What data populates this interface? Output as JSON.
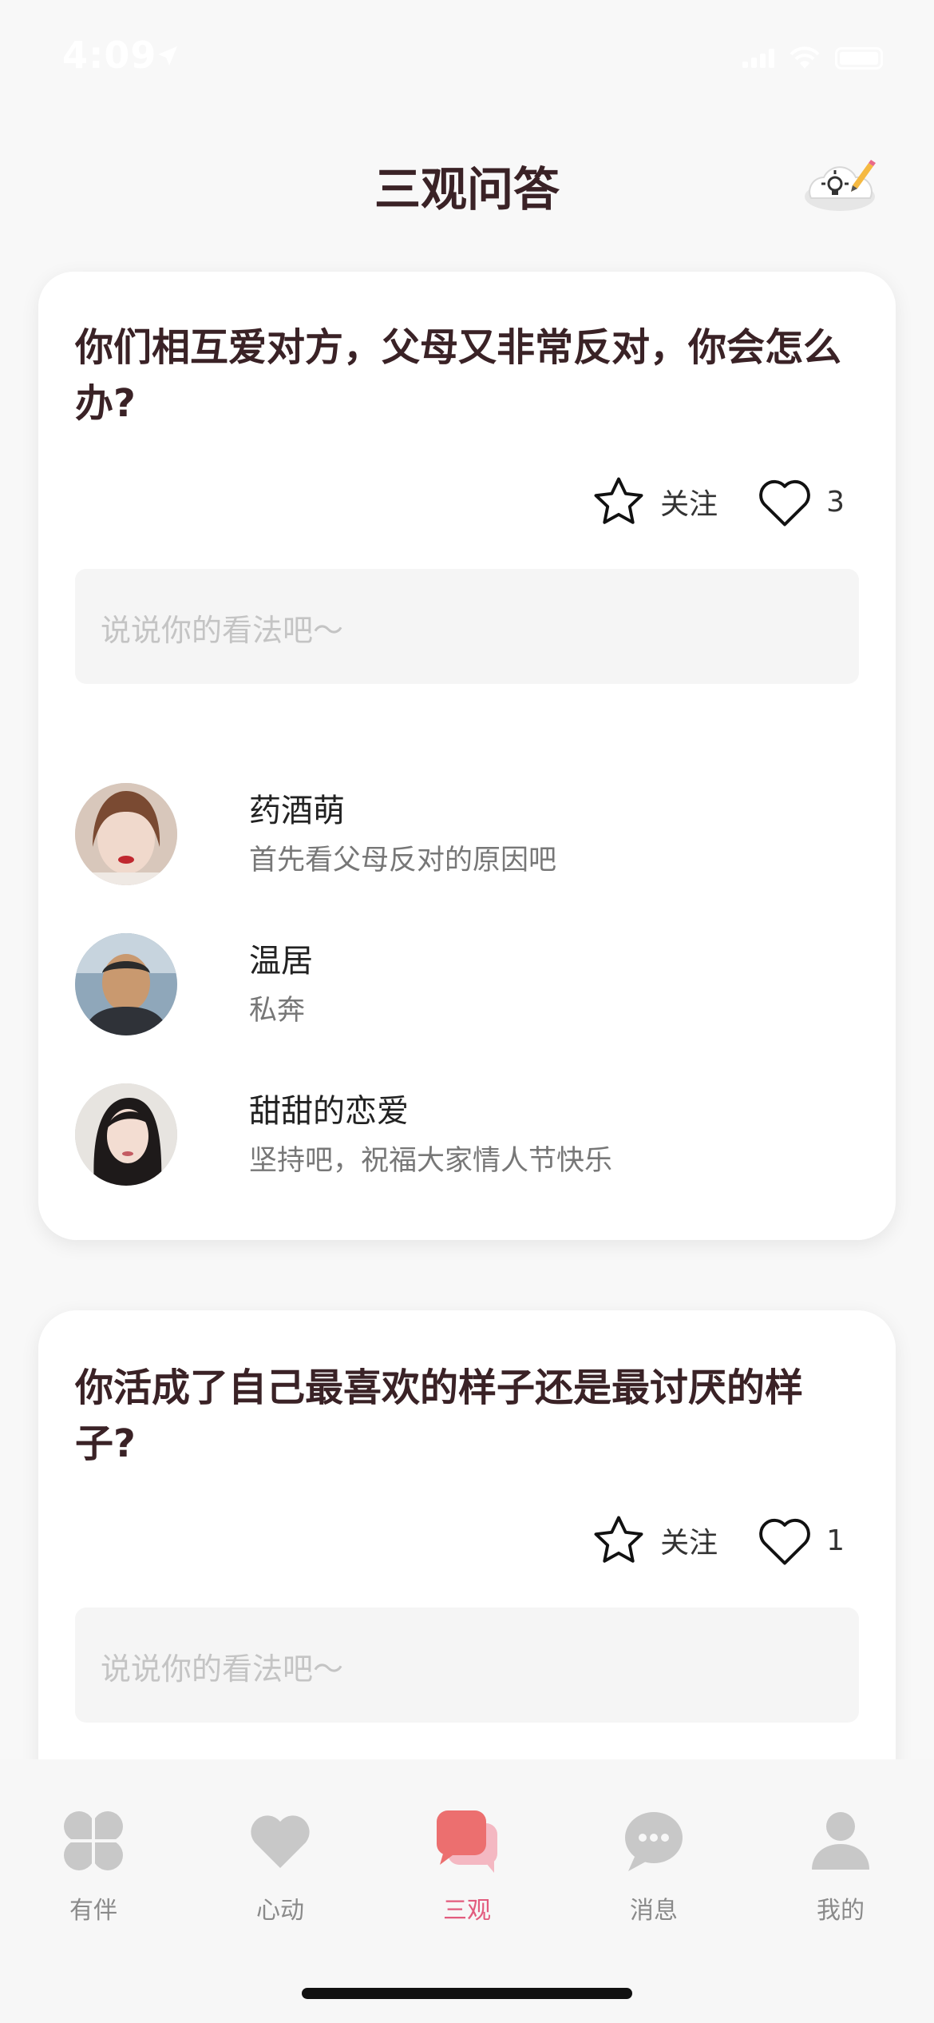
{
  "status_bar": {
    "time": "4:09"
  },
  "header": {
    "title": "三观问答",
    "tip_icon": "lightbulb-pencil-icon"
  },
  "questions": [
    {
      "title": "你们相互爱对方，父母又非常反对，你会怎么办?",
      "follow_label": "关注",
      "like_count": "3",
      "comment_placeholder": "说说你的看法吧～",
      "answers": [
        {
          "name": "药酒萌",
          "text": "首先看父母反对的原因吧"
        },
        {
          "name": "温居",
          "text": "私奔"
        },
        {
          "name": "甜甜的恋爱",
          "text": "坚持吧，祝福大家情人节快乐"
        }
      ]
    },
    {
      "title": "你活成了自己最喜欢的样子还是最讨厌的样子?",
      "follow_label": "关注",
      "like_count": "1",
      "comment_placeholder": "说说你的看法吧～",
      "answers": []
    }
  ],
  "tab_bar": {
    "tabs": [
      {
        "label": "有伴",
        "icon": "clover-icon"
      },
      {
        "label": "心动",
        "icon": "heart-icon"
      },
      {
        "label": "三观",
        "icon": "chat-bubbles-icon",
        "active": true
      },
      {
        "label": "消息",
        "icon": "message-icon"
      },
      {
        "label": "我的",
        "icon": "user-icon"
      }
    ]
  },
  "colors": {
    "title": "#3a2226",
    "accent": "#e25c7e",
    "tab_inactive": "#c8c8c8"
  }
}
